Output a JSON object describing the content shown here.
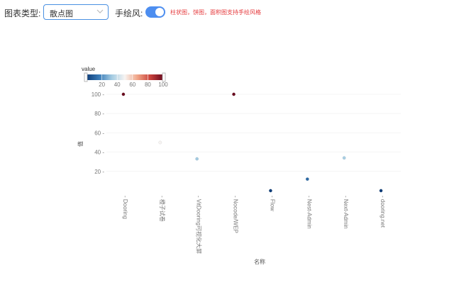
{
  "toolbar": {
    "chart_type_label": "图表类型:",
    "chart_type_value": "散点图",
    "handdrawn_label": "手绘风:",
    "handdrawn_on": true,
    "hint": "柱状图，饼图，面积图支持手绘风格"
  },
  "visualmap": {
    "title": "value",
    "min": 0,
    "max": 100,
    "ticks": [
      20,
      40,
      60,
      80,
      100
    ],
    "colors": [
      "#0f3e79",
      "#3a7cb8",
      "#a6cde3",
      "#f7f4f2",
      "#f0a486",
      "#c9423c",
      "#6a0a1f"
    ]
  },
  "chart_data": {
    "type": "scatter",
    "xlabel": "名称",
    "ylabel": "值",
    "categories": [
      "Dooring",
      "橙子试卷",
      "VitDooring可视化大屏",
      "Nocode/WEP",
      "Flow",
      "Nest-Admin",
      "Next-Admin",
      "dooring.net"
    ],
    "values": [
      100,
      50,
      33,
      100,
      0,
      12,
      34,
      0
    ],
    "yticks": [
      20,
      40,
      60,
      80,
      100
    ],
    "ylim": [
      0,
      100
    ],
    "grid": true
  }
}
